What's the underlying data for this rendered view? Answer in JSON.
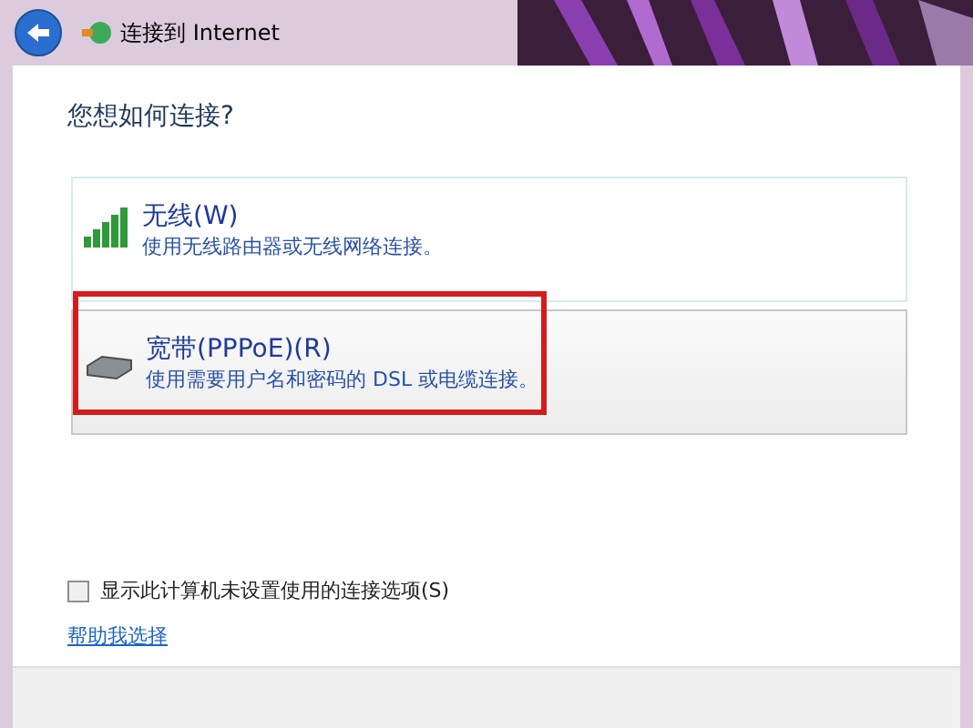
{
  "window": {
    "title": "连接到 Internet"
  },
  "heading": "您想如何连接?",
  "options": [
    {
      "kind": "wireless",
      "label": "无线(W)",
      "description": "使用无线路由器或无线网络连接。",
      "selected": false
    },
    {
      "kind": "broadband",
      "label": "宽带(PPPoE)(R)",
      "description": "使用需要用户名和密码的 DSL 或电缆连接。",
      "selected": true
    }
  ],
  "show_unconfigured": {
    "label": "显示此计算机未设置使用的连接选项(S)",
    "checked": false
  },
  "help_link": "帮助我选择"
}
